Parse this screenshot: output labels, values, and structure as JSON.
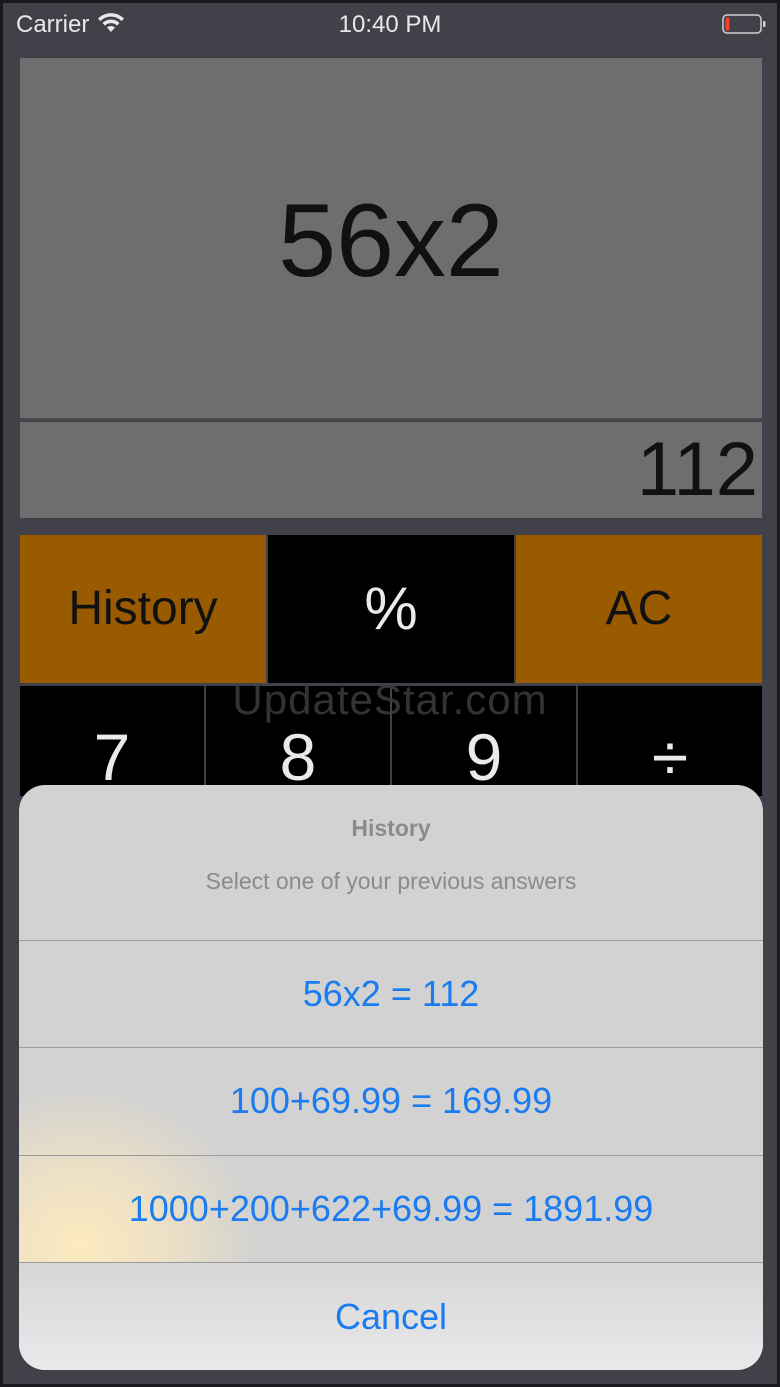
{
  "status_bar": {
    "carrier": "Carrier",
    "time": "10:40 PM",
    "wifi_icon": "wifi-icon",
    "battery_icon": "battery-icon",
    "battery_color": "#ff3b30"
  },
  "display": {
    "expression": "56x2",
    "result": "112"
  },
  "keys": {
    "history": "History",
    "percent": "%",
    "ac": "AC",
    "row": [
      "7",
      "8",
      "9",
      "÷"
    ]
  },
  "watermark": "UpdateStar.com",
  "history_sheet": {
    "title": "History",
    "message": "Select one of your previous answers",
    "options": [
      "56x2 = 112",
      "100+69.99 = 169.99",
      "1000+200+622+69.99 = 1891.99"
    ],
    "cancel": "Cancel"
  },
  "colors": {
    "accent_orange": "#9a5a00",
    "action_blue": "#1a7cf0",
    "display_gray": "#6e6e6e"
  }
}
